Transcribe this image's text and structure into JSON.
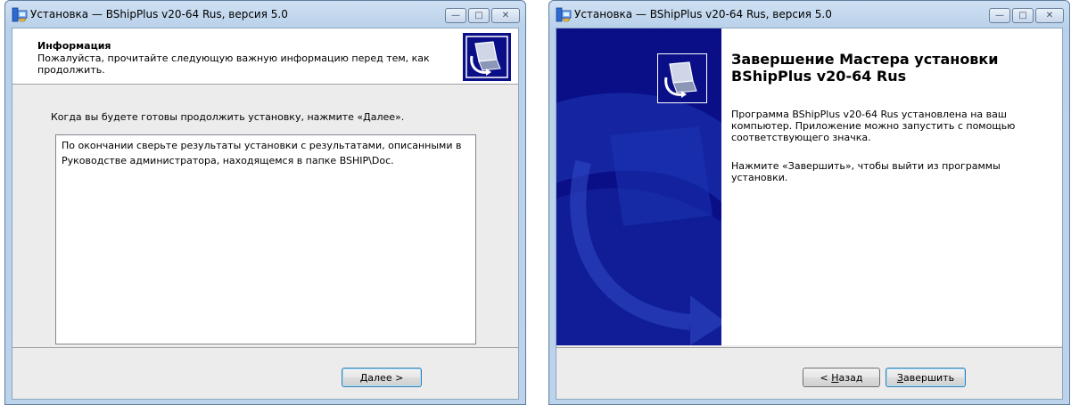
{
  "left_window": {
    "title": "Установка — BShipPlus v20-64 Rus, версия 5.0",
    "header_title": "Информация",
    "header_subtitle": "Пожалуйста, прочитайте следующую важную информацию перед тем, как продолжить.",
    "lead_text": "Когда вы будете готовы продолжить установку, нажмите «Далее».",
    "memo_text": "По окончании сверьте результаты установки с результатами, описанными в Руководстве администратора, находящемся в папке BSHIP\\Doc.",
    "next_accel": "Д",
    "next_rest": "алее >"
  },
  "right_window": {
    "title": "Установка — BShipPlus v20-64 Rus, версия 5.0",
    "finish_title": "Завершение Мастера установки BShipPlus v20-64 Rus",
    "paragraph1": "Программа BShipPlus v20-64 Rus установлена на ваш компьютер. Приложение можно запустить с помощью соответствующего значка.",
    "paragraph2": "Нажмите «Завершить», чтобы выйти из программы установки.",
    "back_prefix": "< ",
    "back_accel": "Н",
    "back_rest": "азад",
    "finish_accel": "З",
    "finish_rest": "авершить"
  },
  "caption_buttons": {
    "minimize": "—",
    "maximize": "□",
    "close": "✕"
  },
  "colors": {
    "side_panel": "#0a0f88",
    "titlebar": "#cfe0f3",
    "dialog_bg": "#ececec"
  }
}
